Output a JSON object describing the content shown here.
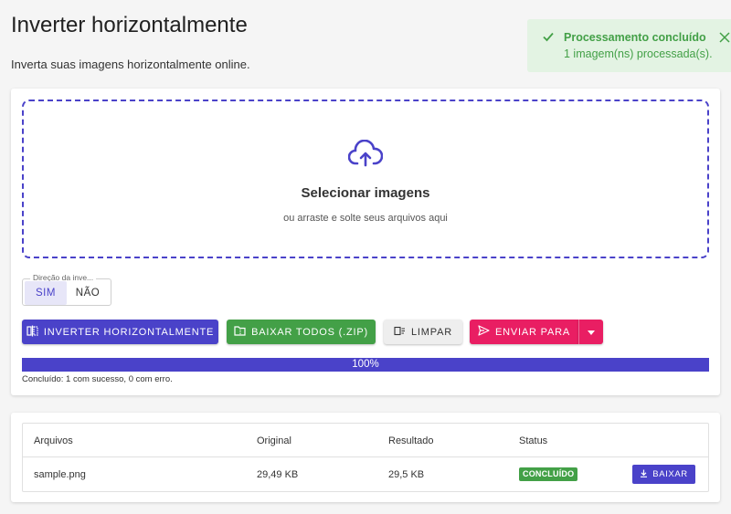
{
  "page": {
    "title": "Inverter horizontalmente",
    "subtitle": "Inverta suas imagens horizontalmente online."
  },
  "toast": {
    "title": "Processamento concluído",
    "message": "1 imagem(ns) processada(s)."
  },
  "dropzone": {
    "title": "Selecionar imagens",
    "subtitle": "ou arraste e solte seus arquivos aqui"
  },
  "direction": {
    "legend": "Direção da inve...",
    "options": [
      "SIM",
      "NÃO"
    ],
    "selected": "SIM"
  },
  "actions": {
    "invert": "INVERTER HORIZONTALMENTE",
    "download_all": "BAIXAR TODOS (.ZIP)",
    "clear": "LIMPAR",
    "send_to": "ENVIAR PARA"
  },
  "progress": {
    "value": 100,
    "label": "100%",
    "status": "Concluído: 1 com sucesso, 0 com erro."
  },
  "table": {
    "headers": [
      "Arquivos",
      "Original",
      "Resultado",
      "Status"
    ],
    "rows": [
      {
        "file": "sample.png",
        "original": "29,49 KB",
        "result": "29,5 KB",
        "status": "CONCLUÍDO",
        "action": "BAIXAR"
      }
    ]
  },
  "colors": {
    "primary": "#4a42c9",
    "success": "#43a047",
    "accent": "#e91e63",
    "toast_bg": "#e3f3e3"
  }
}
